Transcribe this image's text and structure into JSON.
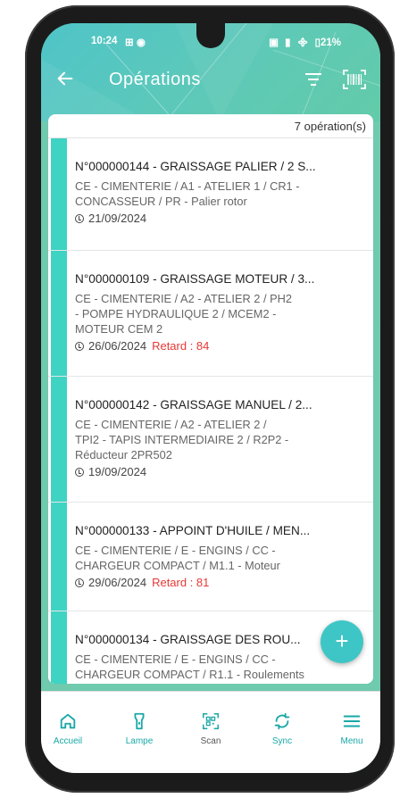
{
  "status_bar": {
    "time": "10:24",
    "battery": "21%"
  },
  "header": {
    "title": "Opérations"
  },
  "list": {
    "count_label": "7 opération(s)",
    "items": [
      {
        "title": "N°000000144 - GRAISSAGE PALIER / 2 S...",
        "line1": "CE - CIMENTERIE / A1 - ATELIER 1 / CR1 -",
        "line2": "CONCASSEUR / PR - Palier rotor",
        "line3": "",
        "date": "21/09/2024",
        "retard": ""
      },
      {
        "title": "N°000000109 - GRAISSAGE MOTEUR / 3...",
        "line1": "CE - CIMENTERIE / A2 - ATELIER 2 / PH2",
        "line2": "- POMPE HYDRAULIQUE 2 / MCEM2 -",
        "line3": "MOTEUR CEM 2",
        "date": "26/06/2024",
        "retard": "Retard : 84"
      },
      {
        "title": "N°000000142 - GRAISSAGE MANUEL / 2...",
        "line1": "CE - CIMENTERIE / A2 - ATELIER 2 /",
        "line2": "TPI2 - TAPIS INTERMEDIAIRE 2 / R2P2 -",
        "line3": "Réducteur 2PR502",
        "date": "19/09/2024",
        "retard": ""
      },
      {
        "title": "N°000000133 - APPOINT D'HUILE / MEN...",
        "line1": "CE - CIMENTERIE / E - ENGINS / CC -",
        "line2": "CHARGEUR COMPACT / M1.1 - Moteur",
        "line3": "",
        "date": "29/06/2024",
        "retard": "Retard : 81"
      },
      {
        "title": "N°000000134 - GRAISSAGE DES ROU...",
        "line1": "CE - CIMENTERIE / E - ENGINS / CC -",
        "line2": "CHARGEUR COMPACT / R1.1 - Roulements",
        "line3": "",
        "date": "",
        "retard": ""
      }
    ]
  },
  "fab": {
    "label": "+"
  },
  "bottom_nav": [
    {
      "label": "Accueil",
      "icon": "home-icon"
    },
    {
      "label": "Lampe",
      "icon": "flashlight-icon"
    },
    {
      "label": "Scan",
      "icon": "qr-scan-icon"
    },
    {
      "label": "Sync",
      "icon": "sync-icon"
    },
    {
      "label": "Menu",
      "icon": "menu-icon"
    }
  ],
  "colors": {
    "header": "#4fc4c8",
    "accent": "#3ed3c3",
    "nav": "#1aa7a7",
    "retard": "#e53935"
  }
}
